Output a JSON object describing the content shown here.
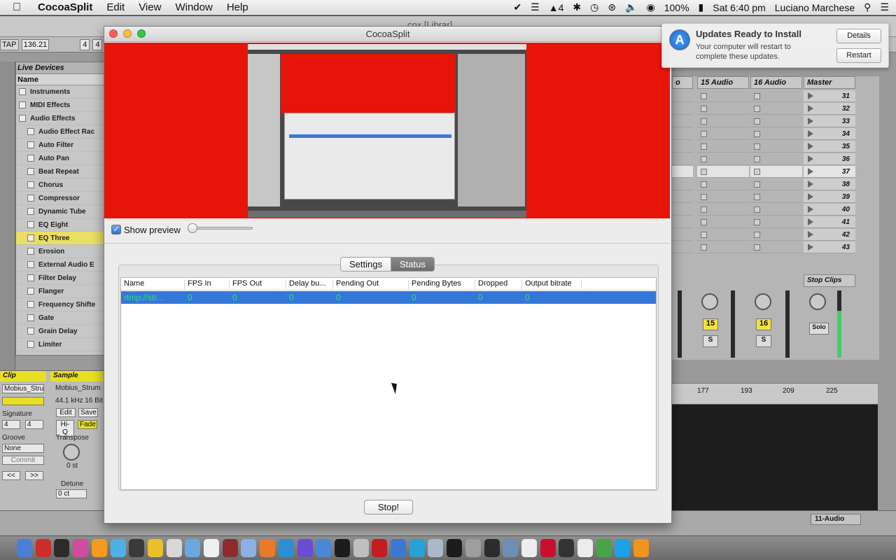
{
  "menubar": {
    "app_name": "CocoaSplit",
    "menus": [
      "Edit",
      "View",
      "Window",
      "Help"
    ],
    "battery": "100%",
    "clock": "Sat 6:40 pm",
    "user": "Luciano Marchese",
    "status_count": "4"
  },
  "notification": {
    "title": "Updates Ready to Install",
    "body": "Your computer will restart to complete these updates.",
    "details_label": "Details",
    "restart_label": "Restart"
  },
  "window": {
    "title": "CocoaSplit",
    "show_preview_label": "Show preview",
    "show_preview_checked": true,
    "tabs": [
      {
        "label": "Settings",
        "active": false
      },
      {
        "label": "Status",
        "active": true
      }
    ],
    "columns": [
      "Name",
      "FPS In",
      "FPS Out",
      "Delay bu...",
      "Pending Out",
      "Pending Bytes",
      "Dropped",
      "Output bitrate"
    ],
    "rows": [
      {
        "name": "rtmp://str...",
        "fps_in": "0",
        "fps_out": "0",
        "delay": "0",
        "pending_out": "0",
        "pending_bytes": "0",
        "dropped": "0",
        "bitrate": "0"
      }
    ],
    "stop_label": "Stop!"
  },
  "live": {
    "title": "cox  [Librar]",
    "tap": "TAP",
    "bpm": "136.21",
    "sig_num": "4",
    "sig_den": "4",
    "browser_header": "Live Devices",
    "browser_col": "Name",
    "browser_items": [
      "Instruments",
      "MIDI Effects",
      "Audio Effects",
      "Audio Effect Rac",
      "Auto Filter",
      "Auto Pan",
      "Beat Repeat",
      "Chorus",
      "Compressor",
      "Dynamic Tube",
      "EQ Eight",
      "EQ Three",
      "Erosion",
      "External Audio E",
      "Filter Delay",
      "Flanger",
      "Frequency Shifte",
      "Gate",
      "Grain Delay",
      "Limiter"
    ],
    "clip_label": "Clip",
    "sample_label": "Sample",
    "clip_name": "Mobius_Stru",
    "sample_name": "Mobius_Strum",
    "sample_info": "44.1 kHz 16 Bit",
    "signature_label": "Signature",
    "groove_label": "Groove",
    "groove_value": "None",
    "commit_label": "Commit",
    "edit_label": "Edit",
    "save_label": "Save",
    "hiq_label": "Hi-Q",
    "fade_label": "Fade",
    "transpose_label": "Transpose",
    "transpose_value": "0 st",
    "detune_label": "Detune",
    "detune_value": "0 ct",
    "nav_prev": "<<",
    "nav_next": ">>",
    "tracks": [
      {
        "name": "15 Audio",
        "num": "15"
      },
      {
        "name": "16 Audio",
        "num": "16"
      }
    ],
    "master_label": "Master",
    "scenes": [
      "31",
      "32",
      "33",
      "34",
      "35",
      "36",
      "37",
      "38",
      "39",
      "40",
      "41",
      "42",
      "43"
    ],
    "stop_clips": "Stop Clips",
    "solo_label": "Solo",
    "s_label": "S",
    "ruler": [
      "177",
      "193",
      "209",
      "225"
    ],
    "track_name": "11-Audio"
  }
}
